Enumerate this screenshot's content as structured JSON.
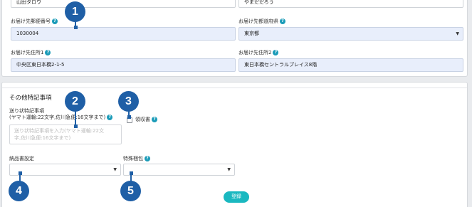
{
  "top_form": {
    "name_value": "山田タロウ",
    "name_kana_value": "やまだだろう",
    "postal": {
      "label": "お届け先郵便番号",
      "value": "1030004"
    },
    "prefecture": {
      "label": "お届け先都道府県",
      "value": "東京都"
    },
    "address1": {
      "label": "お届け先住所1",
      "value": "中央区東日本橋2-1-5"
    },
    "address2": {
      "label": "お届け先住所2",
      "value": "東日本橋セントラルプレイス8階"
    }
  },
  "other_section": {
    "title": "その他特記事項",
    "slip_note": {
      "label_line1": "送り状特記事項",
      "label_line2": "(ヤマト運輸:22文字,佐川急便:16文字まで)",
      "placeholder": "送り状特記事項を入力(ヤマト運輸:22文\n字,佐川急便:16文字まで)"
    },
    "receipt": {
      "label": "領収書",
      "checked": false
    },
    "delivery_slip": {
      "label": "納品書設定",
      "value": ""
    },
    "special_packaging": {
      "label": "特殊梱包",
      "value": ""
    },
    "submit_label": "登録"
  },
  "help_glyph": "?",
  "markers": [
    "1",
    "2",
    "3",
    "4",
    "5"
  ],
  "colors": {
    "accent": "#1ab8c0",
    "help": "#1a9bb8",
    "marker": "#1f5fa6",
    "filled_input": "#e8eefb"
  }
}
